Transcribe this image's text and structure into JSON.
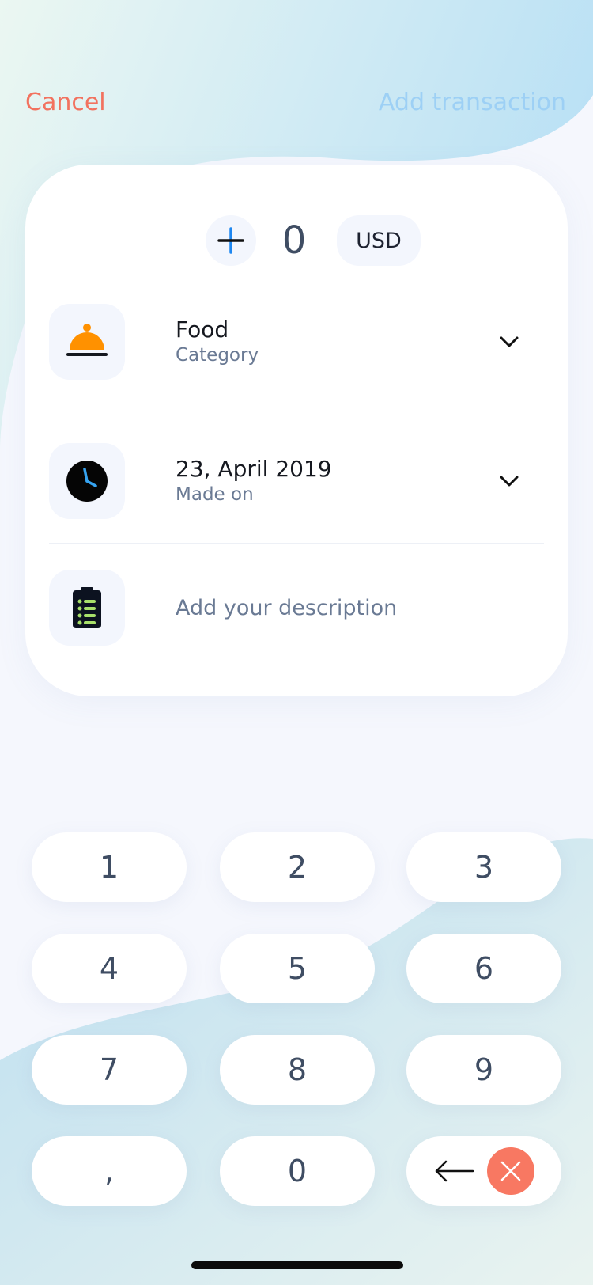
{
  "header": {
    "cancel_label": "Cancel",
    "submit_label": "Add transaction"
  },
  "amount": {
    "sign": "+",
    "value": "0",
    "currency": "USD"
  },
  "category": {
    "title": "Food",
    "subtitle": "Category",
    "icon": "food-cloche-icon"
  },
  "date": {
    "title": "23, April 2019",
    "subtitle": "Made on",
    "icon": "clock-icon"
  },
  "description": {
    "placeholder": "Add your description",
    "value": "",
    "icon": "clipboard-icon"
  },
  "keypad": {
    "keys": [
      "1",
      "2",
      "3",
      "4",
      "5",
      "6",
      "7",
      "8",
      "9",
      ",",
      "0"
    ],
    "backspace_icon": "arrow-left-icon",
    "clear_icon": "close-icon"
  },
  "colors": {
    "accent_red": "#f2725f",
    "accent_blue": "#9dd0f5",
    "food_orange": "#ff9100",
    "text_dark": "#3f4d63"
  }
}
